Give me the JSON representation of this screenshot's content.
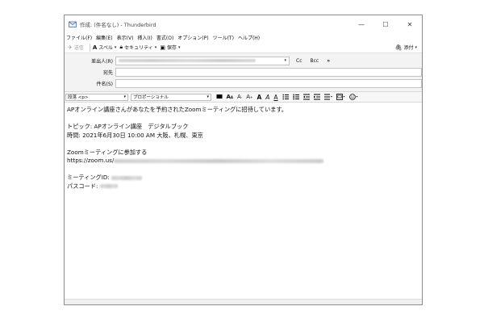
{
  "window": {
    "title": "作成: (件名なし) - Thunderbird",
    "minimize_glyph": "—",
    "maximize_glyph": "☐",
    "close_glyph": "✕"
  },
  "menubar": {
    "items": [
      "ファイル(F)",
      "編集(E)",
      "表示(V)",
      "挿入(I)",
      "書式(O)",
      "オプション(P)",
      "ツール(T)",
      "ヘルプ(H)"
    ]
  },
  "toolbar": {
    "send_label": "送信",
    "spell_label": "スペル",
    "security_label": "セキュリティ",
    "save_label": "保存",
    "attach_label": "添付"
  },
  "headers": {
    "from_label": "差出人(R)",
    "to_label": "宛先",
    "subject_label": "件名(S)",
    "cc_label": "Cc",
    "bcc_label": "Bcc",
    "more_glyph": "»"
  },
  "formatbar": {
    "paragraph_format": "段落 <p>",
    "font": "プロポーショナル"
  },
  "body": {
    "line1": "APオンライン講座さんがあなたを予約されたZoomミーティングに招待しています。",
    "topic": "トピック: APオンライン講座　デジタルブック",
    "time": "時間: 2021年6月30日 10:00 AM 大阪、札幌、東京",
    "join_label": "Zoomミーティングに参加する",
    "join_url_prefix": "https://zoom.us/",
    "meeting_id_label": "ミーティングID:",
    "passcode_label": "パスコード:"
  }
}
